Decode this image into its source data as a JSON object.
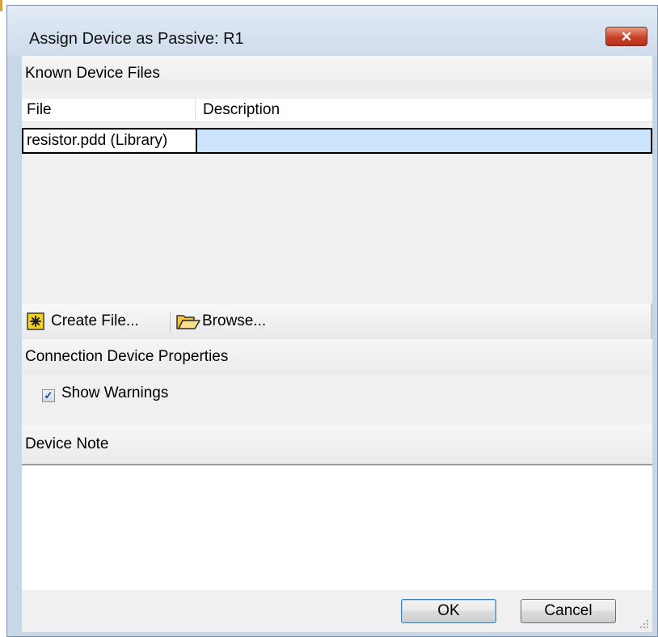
{
  "window": {
    "title": "Assign Device as Passive: R1",
    "close_glyph": "✕"
  },
  "known_files": {
    "header": "Known Device Files",
    "columns": {
      "file": "File",
      "description": "Description"
    },
    "rows": [
      {
        "file": "resistor.pdd (Library)",
        "description": ""
      }
    ]
  },
  "toolbar": {
    "create_label": "Create File...",
    "create_icon": "new-file-icon",
    "browse_label": "Browse...",
    "browse_icon": "folder-open-icon"
  },
  "properties": {
    "header": "Connection Device Properties",
    "show_warnings_label": "Show Warnings",
    "show_warnings_checked": true
  },
  "note": {
    "header": "Device Note",
    "value": ""
  },
  "buttons": {
    "ok": "OK",
    "cancel": "Cancel"
  },
  "colors": {
    "selection": "#cce4fb",
    "close_button": "#c8432a"
  }
}
